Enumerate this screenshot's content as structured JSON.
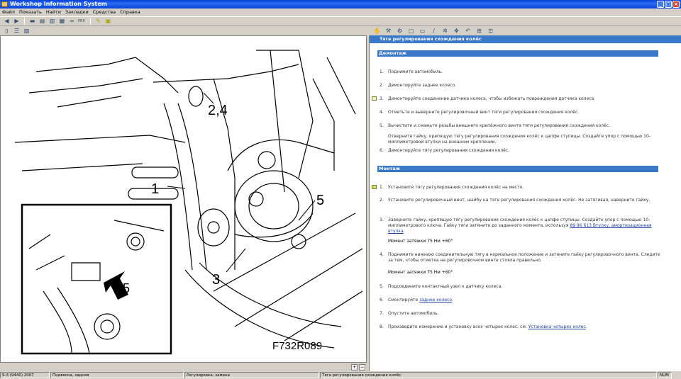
{
  "window": {
    "title": "Workshop Information System"
  },
  "menu": [
    "Файл",
    "Показать",
    "Найти",
    "Закладки",
    "Средства",
    "Справка"
  ],
  "toolbar_text": "PRX",
  "figure": {
    "callouts": [
      "2,4",
      "1",
      "5",
      "3",
      "5"
    ],
    "code": "F732R089"
  },
  "doc": {
    "title": "Тяга регулирования схождения колёс",
    "removal": {
      "heading": "Демонтаж",
      "steps": [
        {
          "n": "1.",
          "text": "Поднимите автомобиль."
        },
        {
          "n": "2.",
          "text": "Демонтируйте заднее колесо."
        },
        {
          "n": "3.",
          "text": "Демонтируйте соединение датчика колеса, чтобы избежать повреждения датчика колеса."
        },
        {
          "n": "4.",
          "text": "Отметьте и выверните регулировочный винт тяги регулирования схождения колёс."
        },
        {
          "n": "5.",
          "text": "Вычистите и смажьте резьбы внешнего крепёжного винта тяги регулирования схождения колёс."
        },
        {
          "n": "6.",
          "text": "Демонтируйте тягу регулирования схождения колёс."
        }
      ],
      "step5_note": "Отверните гайку, крепящую тягу регулирования схождения колёс к цапфе ступицы. Создайте упор с помощью 10-миллиметровой втулки на внешнем креплении."
    },
    "install": {
      "heading": "Монтаж",
      "s1": {
        "n": "1.",
        "text": "Установите тягу регулирования схождения колёс на место."
      },
      "s2": {
        "n": "2.",
        "text": "Установите регулировочный винт, шайбу на тяге регулирования схождения колёс. Не затягивая, наверните гайку."
      },
      "s3": {
        "n": "3.",
        "text": "Заверните гайку, крепящую тягу регулирования схождения колёс к цапфе ступицы. Создайте упор с помощью 10-миллиметрового ключа. Гайку тяги затяните до заданного момента, используя",
        "link": "89 96 613 Втулку, амортизационная втулка",
        "end": "."
      },
      "torque1": "Момент затяжки 75 Нм +60°",
      "s4": {
        "n": "4.",
        "text": "Поднимите нижнюю соединительную тягу в нормальное положение и затяните гайку регулировочного винта. Следите за тем, чтобы отметка на регулировочном винте стояла правильно."
      },
      "torque2": "Момент затяжки 75 Нм +60°",
      "s5": {
        "n": "5.",
        "text": "Подсоедините контактный узел к датчику колеса."
      },
      "s6": {
        "n": "6.",
        "text": "Смонтируйте",
        "link": "заднее колесо",
        "end": "."
      },
      "s7": {
        "n": "7.",
        "text": "Опустите автомобиль."
      },
      "s8": {
        "n": "8.",
        "text": "Произведите измерение и установку всех четырех колес, см.",
        "link": "Установка четырех колес",
        "end": "."
      }
    }
  },
  "status": {
    "c1": "9-3 (9440) 2007",
    "c2": "Подвеска, задняя",
    "c3": "Регулировка, замена",
    "c4": "Тяга регулирования схождения колёс",
    "c5": "NUM"
  },
  "icons": [
    "back-icon",
    "forward-icon",
    "car-icon",
    "print-icon",
    "book-icon",
    "binoculars-icon",
    "pencil-icon",
    "note-icon",
    "zoom-in-icon",
    "zoom-out-icon"
  ]
}
